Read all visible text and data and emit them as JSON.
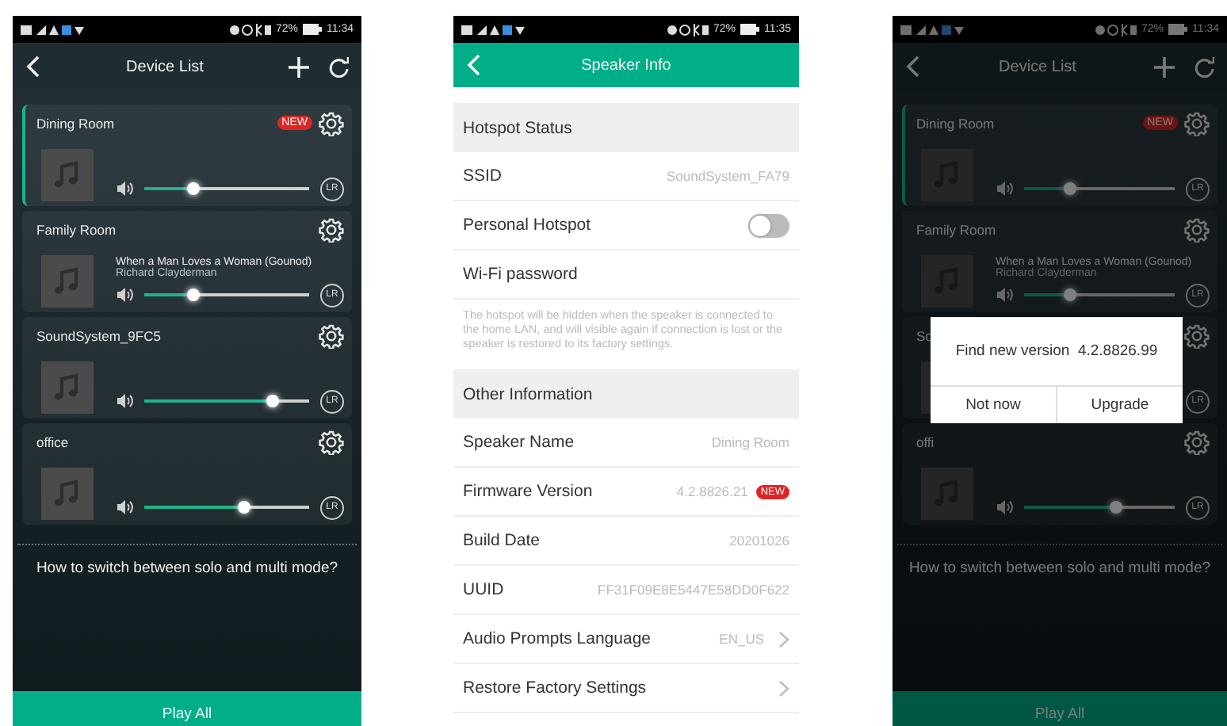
{
  "screens": [
    {
      "kind": "device_list",
      "dimmed": false,
      "status_bar": {
        "battery": "72%",
        "time": "11:34"
      },
      "title": "Device List",
      "devices": [
        {
          "name": "Dining Room",
          "selected": true,
          "badge": "NEW",
          "level": 0.3,
          "channel": "LR"
        },
        {
          "name": "Family Room",
          "selected": false,
          "track": "When a Man Loves a Woman (Gounod)",
          "artist": "Richard Clayderman",
          "level": 0.3,
          "channel": "LR"
        },
        {
          "name": "SoundSystem_9FC5",
          "selected": false,
          "level": 0.78,
          "channel": "LR"
        },
        {
          "name": "office",
          "selected": false,
          "level": 0.61,
          "channel": "LR"
        }
      ],
      "help": "How to switch between solo and multi mode?",
      "play_all": "Play All"
    },
    {
      "kind": "speaker_info",
      "status_bar": {
        "battery": "72%",
        "time": "11:35"
      },
      "title": "Speaker Info",
      "sections": [
        {
          "header": "Hotspot Status",
          "rows": [
            {
              "kind": "value",
              "label": "SSID",
              "value": "SoundSystem_FA79"
            },
            {
              "kind": "toggle",
              "label": "Personal Hotspot",
              "on": false
            },
            {
              "kind": "plain",
              "label": "Wi-Fi password"
            }
          ],
          "note": "The hotspot will be hidden when the speaker is connected to the home LAN, and will visible again if connection is lost or the speaker is restored to its factory settings."
        },
        {
          "header": "Other Information",
          "rows": [
            {
              "kind": "value",
              "label": "Speaker Name",
              "value": "Dining Room"
            },
            {
              "kind": "value",
              "label": "Firmware Version",
              "value": "4.2.8826.21",
              "badge": "NEW"
            },
            {
              "kind": "value",
              "label": "Build Date",
              "value": "20201026"
            },
            {
              "kind": "value",
              "label": "UUID",
              "value": "FF31F09E8E5447E58DD0F622"
            },
            {
              "kind": "link",
              "label": "Audio Prompts Language",
              "value": "EN_US"
            },
            {
              "kind": "link",
              "label": "Restore Factory Settings"
            }
          ]
        }
      ]
    },
    {
      "kind": "device_list",
      "dimmed": true,
      "status_bar": {
        "battery": "72%",
        "time": "11:34"
      },
      "title": "Device List",
      "devices": [
        {
          "name": "Dining Room",
          "selected": true,
          "badge": "NEW",
          "level": 0.3,
          "channel": "LR"
        },
        {
          "name": "Family Room",
          "selected": false,
          "track": "When a Man Loves a Woman (Gounod)",
          "artist": "Richard Clayderman",
          "level": 0.3,
          "channel": "LR"
        },
        {
          "name": "So",
          "selected": false,
          "channel": "LR"
        },
        {
          "name": "offi",
          "selected": false,
          "level": 0.61,
          "channel": "LR"
        }
      ],
      "help": "How to switch between solo and multi mode?",
      "play_all": "Play All",
      "dialog": {
        "message": "Find new version  4.2.8826.99",
        "buttons": [
          "Not now",
          "Upgrade"
        ]
      }
    }
  ]
}
